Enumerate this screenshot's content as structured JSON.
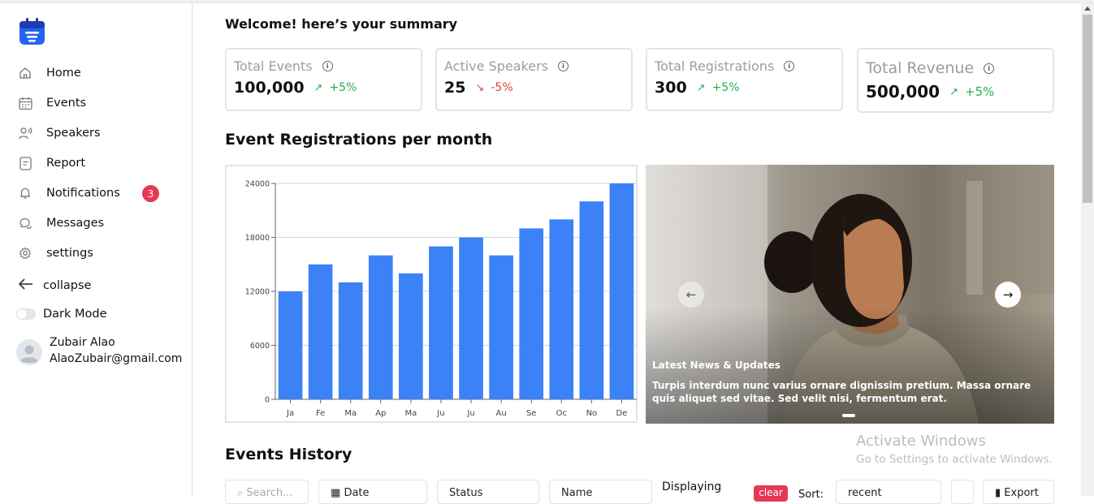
{
  "sidebar": {
    "items": [
      {
        "label": "Home",
        "icon": "home-icon"
      },
      {
        "label": "Events",
        "icon": "calendar-icon"
      },
      {
        "label": "Speakers",
        "icon": "speaker-icon"
      },
      {
        "label": "Report",
        "icon": "report-icon"
      },
      {
        "label": "Notifications",
        "icon": "bell-icon"
      },
      {
        "label": "Messages",
        "icon": "chat-icon"
      },
      {
        "label": "settings",
        "icon": "gear-icon"
      }
    ],
    "notifications_count": "3",
    "collapse_label": "collapse",
    "dark_mode_label": "Dark Mode",
    "dark_mode_on": false,
    "user": {
      "name": "Zubair Alao",
      "email": "AlaoZubair@gmail.com"
    }
  },
  "welcome": "Welcome! here’s your summary",
  "stats": [
    {
      "title": "Total Events",
      "value": "100,000",
      "arrow": "↗",
      "change": "+5%",
      "trend": "up"
    },
    {
      "title": "Active Speakers",
      "value": "25",
      "arrow": "↘",
      "change": "-5%",
      "trend": "down"
    },
    {
      "title": "Total Registrations",
      "value": "300",
      "arrow": "↗",
      "change": "+5%",
      "trend": "up"
    },
    {
      "title": "Total Revenue",
      "value": "500,000",
      "arrow": "↗",
      "change": "+5%",
      "trend": "up"
    }
  ],
  "chart_section_title": "Event Registrations per month",
  "chart_data": {
    "type": "bar",
    "categories": [
      "Ja",
      "Fe",
      "Ma",
      "Ap",
      "Ma",
      "Ju",
      "Ju",
      "Au",
      "Se",
      "Oc",
      "No",
      "De"
    ],
    "values": [
      12000,
      15000,
      13000,
      16000,
      14000,
      17000,
      18000,
      16000,
      19000,
      20000,
      22000,
      24000
    ],
    "yticks": [
      "0",
      "6000",
      "12000",
      "18000",
      "24000"
    ],
    "ylim": [
      0,
      24000
    ],
    "grid": true,
    "bar_color": "#3b82f6"
  },
  "hero": {
    "title": "Latest News & Updates",
    "body": "Turpis interdum nunc varius ornare dignissim pretium. Massa ornare quis aliquet sed vitae. Sed velit nisi, fermentum erat."
  },
  "history": {
    "title": "Events History",
    "filters": {
      "search_placeholder": "Search...",
      "date_label": "Date",
      "status_label": "Status",
      "name_label": "Name",
      "displaying_label": "Displaying",
      "clear_label": "clear",
      "sort_label": "Sort:",
      "sort_value": "recent",
      "export_label": "Export"
    }
  },
  "watermark": {
    "title": "Activate Windows",
    "subtitle": "Go to Settings to activate Windows."
  },
  "colors": {
    "accent": "#3b82f6",
    "badge": "#e53955",
    "up": "#22b14c",
    "down": "#e43d3d"
  }
}
